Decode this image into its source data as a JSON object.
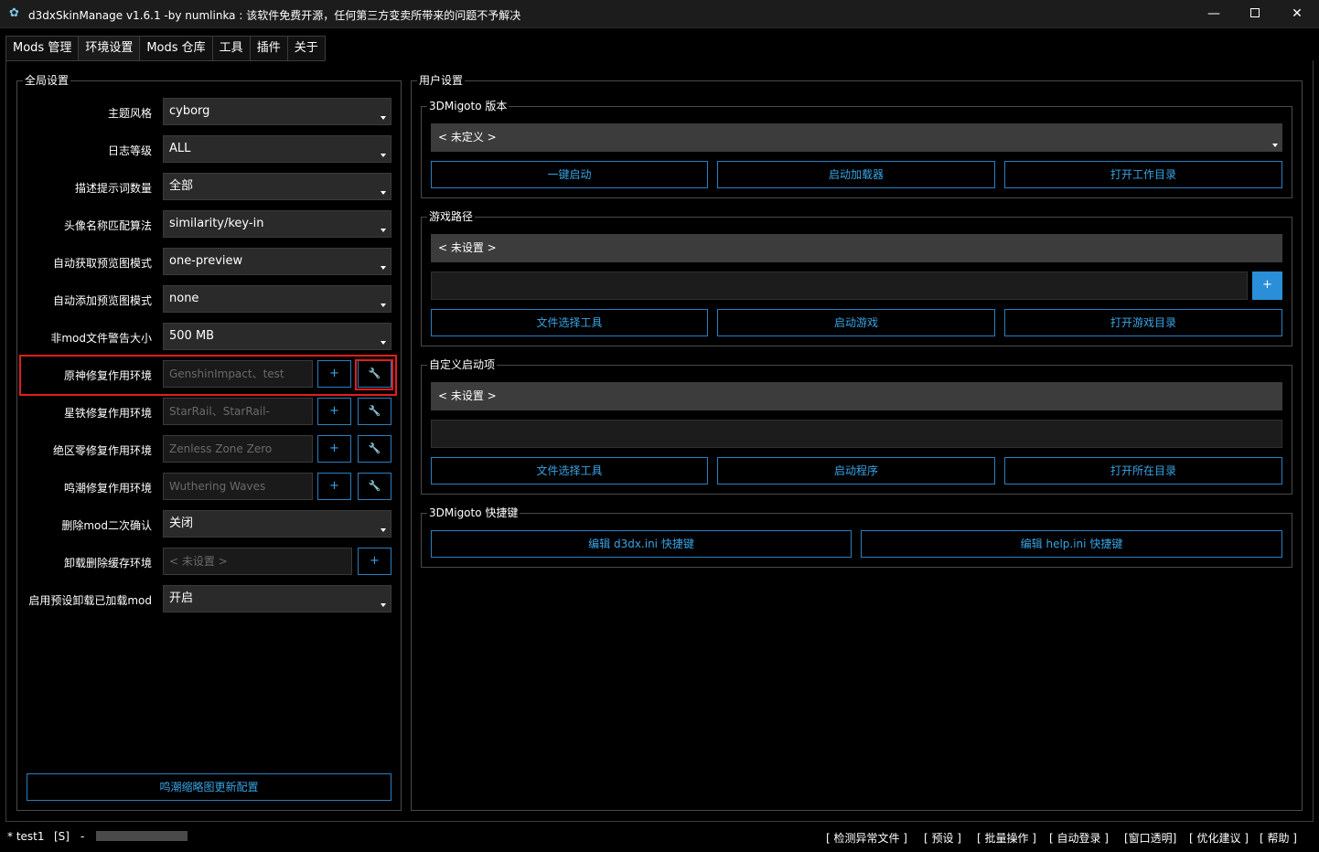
{
  "window": {
    "title": "d3dxSkinManage v1.6.1 -by numlinka : 该软件免费开源，任何第三方变卖所带来的问题不予解决",
    "icon": "app-logo-icon",
    "minimize_glyph": "—",
    "close_glyph": "✕"
  },
  "tabs": [
    {
      "label": "Mods 管理"
    },
    {
      "label": "环境设置",
      "active": true
    },
    {
      "label": "Mods 仓库"
    },
    {
      "label": "工具"
    },
    {
      "label": "插件"
    },
    {
      "label": "关于"
    }
  ],
  "global_settings": {
    "title": "全局设置",
    "theme": {
      "label": "主题风格",
      "value": "cyborg"
    },
    "log_level": {
      "label": "日志等级",
      "value": "ALL"
    },
    "hint_count": {
      "label": "描述提示词数量",
      "value": "全部"
    },
    "avatar_match": {
      "label": "头像名称匹配算法",
      "value": "similarity/key-in"
    },
    "auto_fetch_preview": {
      "label": "自动获取预览图模式",
      "value": "one-preview"
    },
    "auto_add_preview": {
      "label": "自动添加预览图模式",
      "value": "none"
    },
    "nonmod_warn_size": {
      "label": "非mod文件警告大小",
      "value": "500 MB"
    },
    "genshin_env": {
      "label": "原神修复作用环境",
      "value": "GenshinImpact、test"
    },
    "starrail_env": {
      "label": "星铁修复作用环境",
      "value": "StarRail、StarRail-"
    },
    "zzz_env": {
      "label": "绝区零修复作用环境",
      "value": "Zenless Zone Zero"
    },
    "wuwa_env": {
      "label": "鸣潮修复作用环境",
      "value": "Wuthering Waves"
    },
    "delete_confirm": {
      "label": "删除mod二次确认",
      "value": "关闭"
    },
    "unload_cache_env": {
      "label": "卸载删除缓存环境",
      "value": "< 未设置 >"
    },
    "preset_unload": {
      "label": "启用预设卸载已加载mod",
      "value": "开启"
    },
    "add_glyph": "+",
    "wrench_glyph": "🔧",
    "wuwa_thumbnail_button": "鸣潮缩略图更新配置"
  },
  "user_settings": {
    "title": "用户设置",
    "migoto_version": {
      "title": "3DMigoto 版本",
      "value": "< 未定义 >",
      "btn_launch": "一键启动",
      "btn_loader": "启动加载器",
      "btn_workdir": "打开工作目录"
    },
    "game_path": {
      "title": "游戏路径",
      "value": "< 未设置 >",
      "add_glyph": "+",
      "btn_file_picker": "文件选择工具",
      "btn_launch_game": "启动游戏",
      "btn_game_dir": "打开游戏目录"
    },
    "custom_launch": {
      "title": "自定义启动项",
      "value": "< 未设置 >",
      "btn_file_picker": "文件选择工具",
      "btn_launch_program": "启动程序",
      "btn_open_dir": "打开所在目录"
    },
    "hotkeys": {
      "title": "3DMigoto 快捷键",
      "btn_d3dx": "编辑 d3dx.ini 快捷键",
      "btn_help": "编辑 help.ini 快捷键"
    }
  },
  "statusbar": {
    "user": "* test1",
    "flag": "[S]",
    "dash": "-",
    "actions": [
      "[ 检测异常文件 ]",
      "[ 预设 ]",
      "[ 批量操作 ]",
      "[ 自动登录 ]",
      "[窗口透明]",
      "[ 优化建议 ]",
      "[ 帮助 ]"
    ]
  },
  "colors": {
    "accent": "#38a4e6",
    "highlight": "#e21d1d",
    "background": "#000000"
  }
}
